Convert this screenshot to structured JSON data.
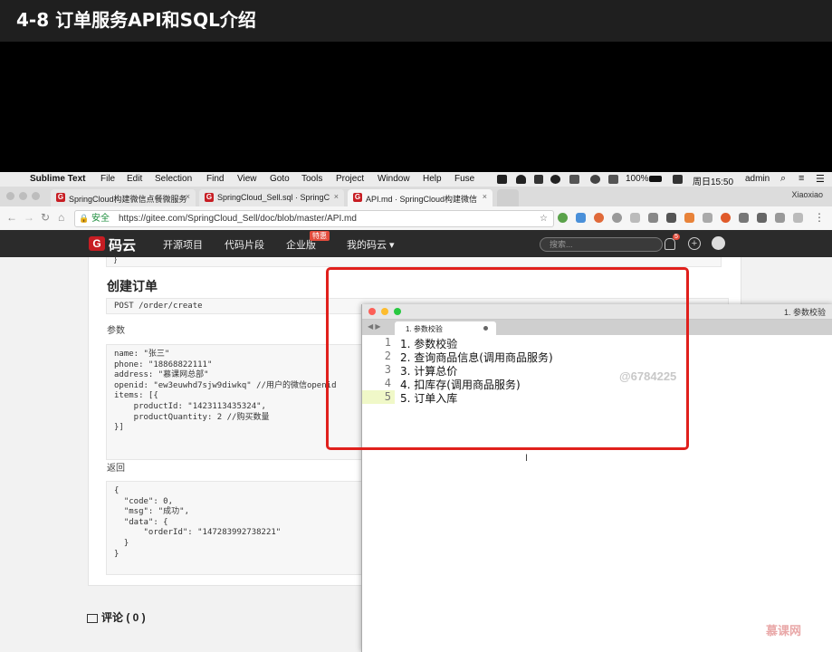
{
  "video": {
    "title": "4-8 订单服务API和SQL介绍",
    "watermark_logo": "慕课网"
  },
  "menubar": {
    "apple": "",
    "items": [
      "Sublime Text",
      "File",
      "Edit",
      "Selection",
      "Find",
      "View",
      "Goto",
      "Tools",
      "Project",
      "Window",
      "Help",
      "Fuse"
    ],
    "battery": "100%",
    "clock": "周日15:50",
    "user": "admin"
  },
  "browser": {
    "tabs": [
      {
        "label": "SpringCloud构建微信点餐微服务",
        "active": false
      },
      {
        "label": "SpringCloud_Sell.sql · SpringC",
        "active": false
      },
      {
        "label": "API.md · SpringCloud构建微信",
        "active": true
      }
    ],
    "profile_name": "Xiaoxiao",
    "secure_label": "安全",
    "url": "https://gitee.com/SpringCloud_Sell/doc/blob/master/API.md"
  },
  "gitee_nav": {
    "logo_text": "码云",
    "links": [
      "开源项目",
      "代码片段",
      "企业版",
      "我的码云 ▾"
    ],
    "special_badge": "特惠",
    "search_placeholder": "搜索...",
    "notification_count": "5"
  },
  "doc": {
    "prev_tail": "}",
    "section_title": "创建订单",
    "endpoint": "POST /order/create",
    "params_label": "参数",
    "params_code": "name: \"张三\"\nphone: \"18868822111\"\naddress: \"慕课网总部\"\nopenid: \"ew3euwhd7sjw9diwkq\" //用户的微信openid\nitems: [{\n    productId: \"1423113435324\",\n    productQuantity: 2 //购买数量\n}]",
    "return_label": "返回",
    "return_code": "{\n  \"code\": 0,\n  \"msg\": \"成功\",\n  \"data\": {\n      \"orderId\": \"147283992738221\"\n  }\n}",
    "comments_label": "评论 ( 0 )"
  },
  "sublime": {
    "window_title": "1. 参数校验",
    "tab_label": "1. 参数校验",
    "nav_arrows": "◀ ▶",
    "lines": [
      {
        "num": "1",
        "text": "1.  参数校验"
      },
      {
        "num": "2",
        "text": "2.  查询商品信息(调用商品服务)"
      },
      {
        "num": "3",
        "text": "3.  计算总价"
      },
      {
        "num": "4",
        "text": "4.  扣库存(调用商品服务)"
      },
      {
        "num": "5",
        "text": "5.  订单入库"
      }
    ],
    "overlay_watermark": "@6784225",
    "cursor_glyph": "I"
  },
  "colors": {
    "highlight_box": "#e0201c",
    "gitee_red": "#c71d23",
    "gitee_nav_bg": "#2b2b2b"
  }
}
